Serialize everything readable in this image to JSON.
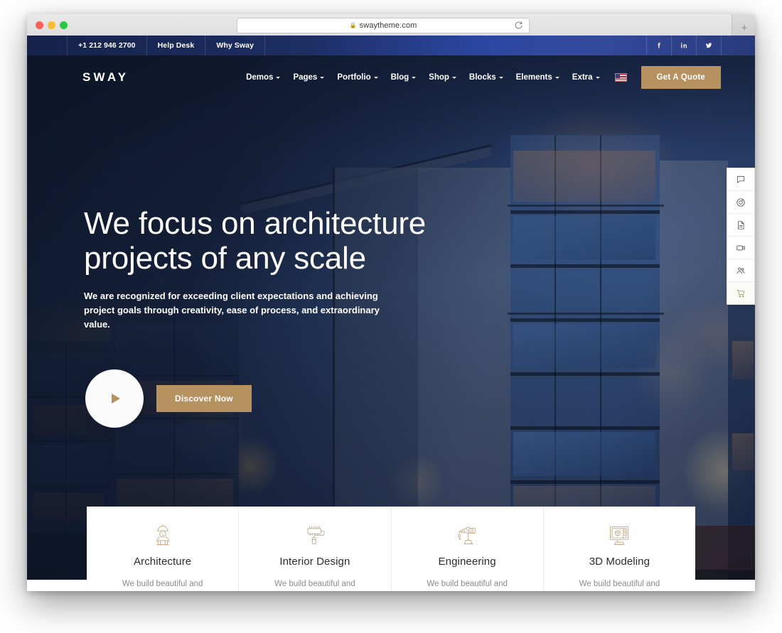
{
  "browser": {
    "url": "swaytheme.com",
    "lock_icon": "lock-icon",
    "reload_icon": "reload-icon",
    "new_tab_label": "+",
    "traffic_lights": [
      "close",
      "minimize",
      "zoom"
    ]
  },
  "topbar": {
    "links": [
      {
        "label": "+1 212 946 2700",
        "name": "phone"
      },
      {
        "label": "Help Desk",
        "name": "help-desk"
      },
      {
        "label": "Why Sway",
        "name": "why-sway"
      }
    ],
    "social": [
      {
        "label": "facebook",
        "name": "facebook-icon"
      },
      {
        "label": "linkedin",
        "name": "linkedin-icon"
      },
      {
        "label": "twitter",
        "name": "twitter-icon"
      }
    ],
    "bg_color": "#1d2e63"
  },
  "nav": {
    "logo": "SWAY",
    "items": [
      {
        "label": "Demos",
        "has_caret": true
      },
      {
        "label": "Pages",
        "has_caret": true
      },
      {
        "label": "Portfolio",
        "has_caret": true
      },
      {
        "label": "Blog",
        "has_caret": true
      },
      {
        "label": "Shop",
        "has_caret": true
      },
      {
        "label": "Blocks",
        "has_caret": true
      },
      {
        "label": "Elements",
        "has_caret": true
      },
      {
        "label": "Extra",
        "has_caret": true
      }
    ],
    "flag": "us-flag-icon",
    "cta_label": "Get A Quote",
    "cta_color": "#b59260"
  },
  "hero": {
    "title_line1": "We focus on architecture",
    "title_line2": "projects of any scale",
    "subtitle": "We are recognized for exceeding client expectations and achieving project goals through creativity, ease of process, and extraordinary value.",
    "play_icon": "play-icon",
    "discover_label": "Discover Now",
    "discover_color": "#b59260"
  },
  "right_rail": [
    {
      "name": "chat-bubble-icon",
      "label": "chat"
    },
    {
      "name": "camera-icon",
      "label": "camera"
    },
    {
      "name": "document-icon",
      "label": "document"
    },
    {
      "name": "video-camera-icon",
      "label": "video"
    },
    {
      "name": "people-icon",
      "label": "people"
    },
    {
      "name": "shopping-cart-icon",
      "label": "cart"
    }
  ],
  "cards": [
    {
      "icon": "architect-worker-icon",
      "title": "Architecture",
      "desc": "We build beautiful and"
    },
    {
      "icon": "paint-roller-icon",
      "title": "Interior Design",
      "desc": "We build beautiful and"
    },
    {
      "icon": "crane-icon",
      "title": "Engineering",
      "desc": "We build beautiful and"
    },
    {
      "icon": "3d-monitor-icon",
      "title": "3D Modeling",
      "desc": "We build beautiful and"
    }
  ]
}
